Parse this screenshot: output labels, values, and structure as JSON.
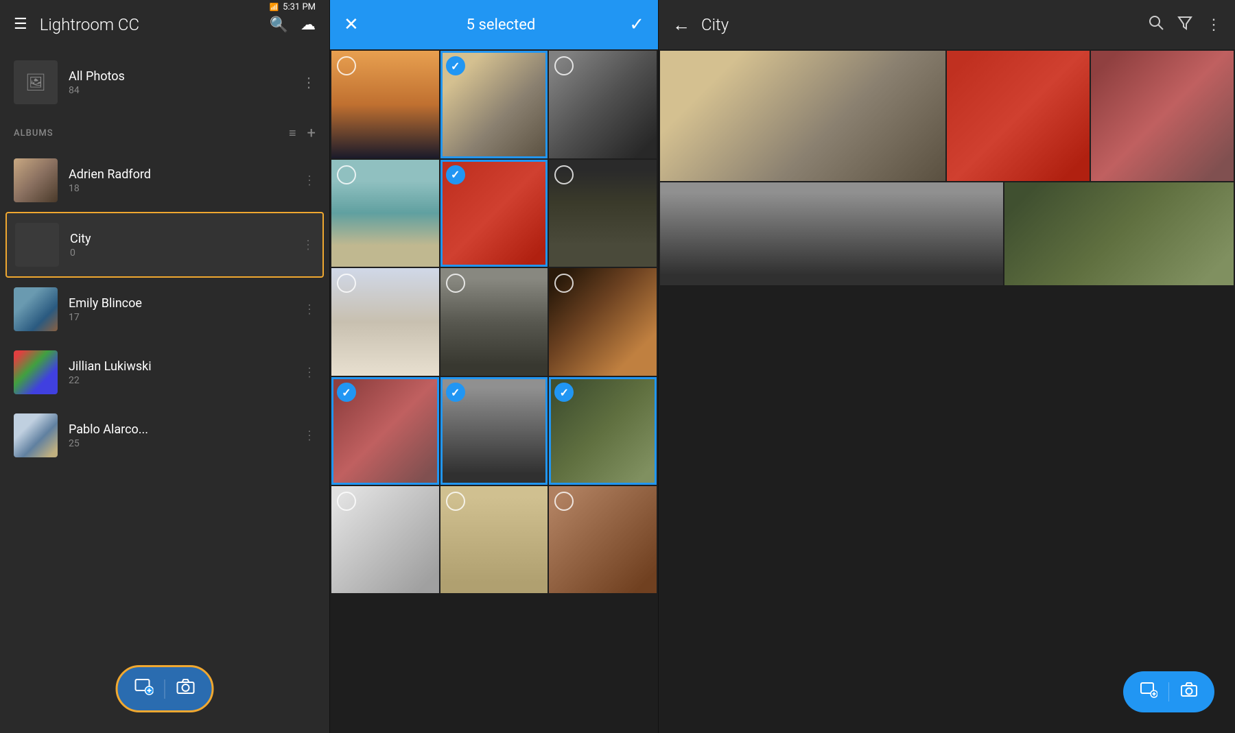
{
  "statusBar": {
    "time": "5:31 PM",
    "signal": "4G+"
  },
  "sidebar": {
    "title": "Lightroom CC",
    "allPhotos": {
      "label": "All Photos",
      "count": "84"
    },
    "albumsSection": {
      "label": "ALBUMS",
      "filterIcon": "≡",
      "addIcon": "+"
    },
    "albums": [
      {
        "name": "Adrien Radford",
        "count": "18",
        "thumbClass": "thumb-adrien",
        "selected": false
      },
      {
        "name": "City",
        "count": "0",
        "thumbClass": "thumb-city",
        "selected": true
      },
      {
        "name": "Emily Blincoe",
        "count": "17",
        "thumbClass": "thumb-emily",
        "selected": false
      },
      {
        "name": "Jillian Lukiwski",
        "count": "22",
        "thumbClass": "thumb-jillian",
        "selected": false
      },
      {
        "name": "Pablo Alarco...",
        "count": "25",
        "thumbClass": "thumb-pablo",
        "selected": false
      }
    ],
    "bottomBar": {
      "importLabel": "import",
      "cameraLabel": "camera"
    }
  },
  "selectionPanel": {
    "selectedCount": "5 selected",
    "closeIcon": "×",
    "confirmIcon": "✓"
  },
  "cityPanel": {
    "title": "City",
    "backIcon": "←",
    "searchIcon": "🔍",
    "filterIcon": "▽",
    "moreIcon": "⋮",
    "bottomBar": {
      "importLabel": "import",
      "cameraLabel": "camera"
    }
  }
}
